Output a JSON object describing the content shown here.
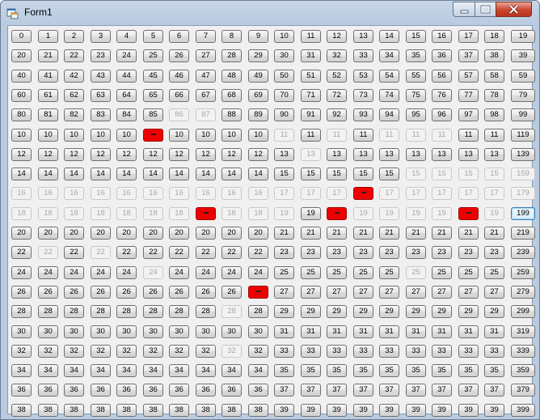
{
  "window": {
    "title": "Form1"
  },
  "colors": {
    "flag": "#ee0000",
    "focus": "#3c7fb1"
  },
  "grid": {
    "rows": 20,
    "columns": 20,
    "disabled": [
      86,
      87,
      110,
      112,
      114,
      115,
      116,
      131,
      155,
      156,
      157,
      158,
      159,
      160,
      161,
      162,
      163,
      164,
      165,
      166,
      167,
      168,
      169,
      170,
      171,
      172,
      174,
      175,
      176,
      177,
      178,
      179,
      180,
      181,
      182,
      183,
      184,
      185,
      186,
      188,
      189,
      190,
      192,
      193,
      194,
      195,
      196,
      198,
      221,
      223,
      245,
      255,
      288,
      328
    ],
    "flagged": [
      105,
      173,
      187,
      192,
      197,
      269
    ],
    "focused": 199,
    "flag_icon": "flag-icon"
  }
}
